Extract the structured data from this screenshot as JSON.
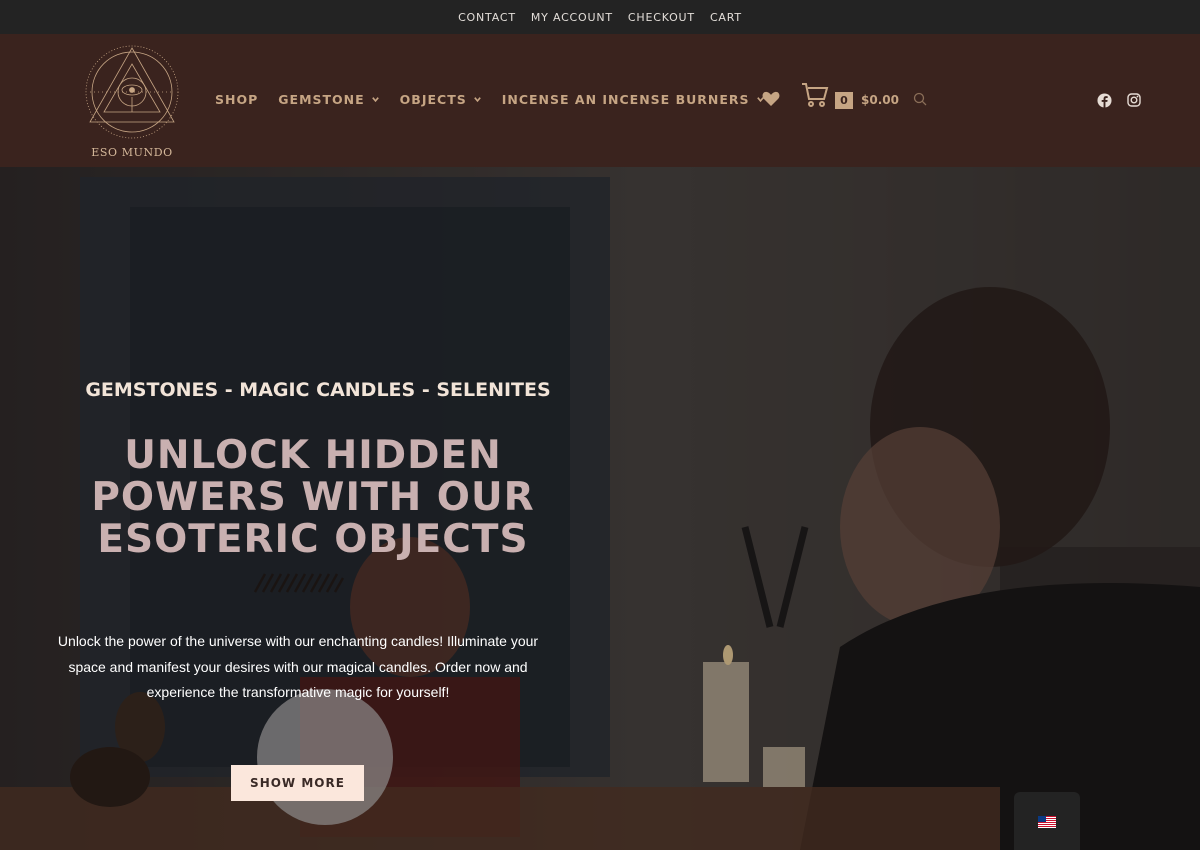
{
  "topbar": {
    "links": [
      "CONTACT",
      "MY ACCOUNT",
      "CHECKOUT",
      "CART"
    ]
  },
  "header": {
    "logo_text": "ESO MUNDO",
    "nav": [
      {
        "label": "SHOP",
        "has_dropdown": false
      },
      {
        "label": "GEMSTONE",
        "has_dropdown": true
      },
      {
        "label": "OBJECTS",
        "has_dropdown": true
      },
      {
        "label": "INCENSE AN INCENSE BURNERS",
        "has_dropdown": true
      }
    ],
    "cart_count": "0",
    "cart_total": "$0.00",
    "icons": [
      "heart-icon",
      "cart-icon",
      "search-icon",
      "facebook-icon",
      "instagram-icon"
    ]
  },
  "hero": {
    "subtitle": "GEMSTONES - MAGIC CANDLES - SELENITES",
    "title_lines": [
      "UNLOCK HIDDEN",
      "POWERS WITH OUR",
      "ESOTERIC OBJECTS"
    ],
    "description_lines": [
      "Unlock the power of the universe with our enchanting candles! Illuminate your",
      "space and manifest your desires with our magical candles. Order now and",
      "experience the transformative magic for yourself!"
    ],
    "cta_label": "SHOW MORE"
  },
  "language": {
    "flag": "us-flag-icon"
  },
  "colors": {
    "topbar_bg": "#232323",
    "header_bg": "#3a231e",
    "accent": "#c6a584",
    "cta_bg": "#fbe7dc"
  }
}
